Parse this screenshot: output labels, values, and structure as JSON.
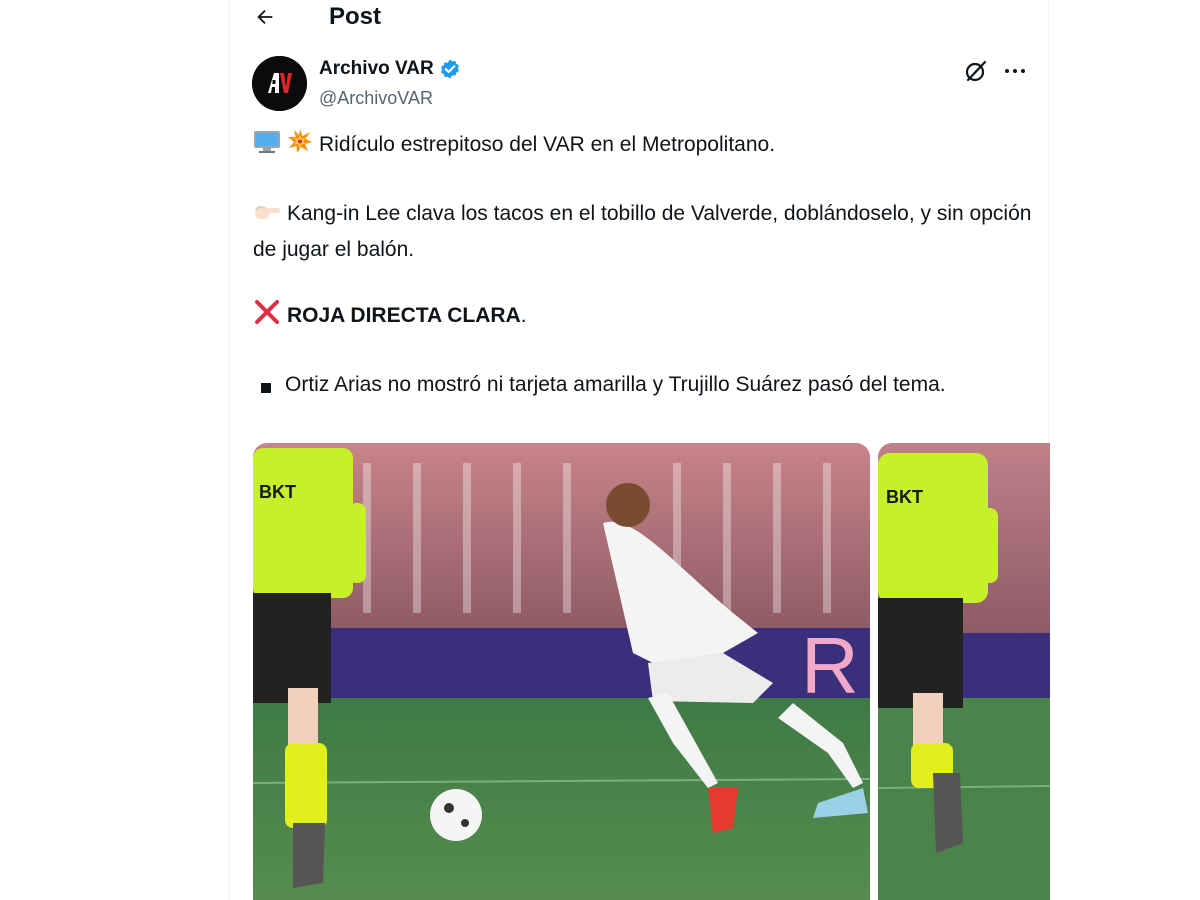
{
  "header": {
    "title": "Post"
  },
  "author": {
    "display_name": "Archivo VAR",
    "handle": "@ArchivoVAR",
    "verified": true,
    "avatar_text": "AV"
  },
  "tweet": {
    "line1": "Ridículo estrepitoso del VAR en el Metropolitano.",
    "line2": "Kang-in Lee clava los tacos en el tobillo de Valverde, doblándoselo, y sin opción de jugar el balón.",
    "line3_bold": "ROJA DIRECTA CLARA",
    "line3_end": ".",
    "line4": "Ortiz Arias no mostró ni tarjeta amarilla y Trujillo Suárez pasó del tema."
  },
  "media": {
    "image1_alt": "Referee and player on pitch",
    "image2_alt": "Referee running",
    "sponsor_text": "BKT"
  },
  "colors": {
    "verified_blue": "#1d9bf0",
    "text": "#0f1419",
    "muted": "#536471"
  },
  "icons": [
    "back-arrow-icon",
    "verified-badge-icon",
    "grok-icon",
    "more-icon",
    "computer-emoji-icon",
    "collision-emoji-icon",
    "pointing-hand-emoji-icon",
    "cross-mark-emoji-icon",
    "square-bullet-icon"
  ]
}
